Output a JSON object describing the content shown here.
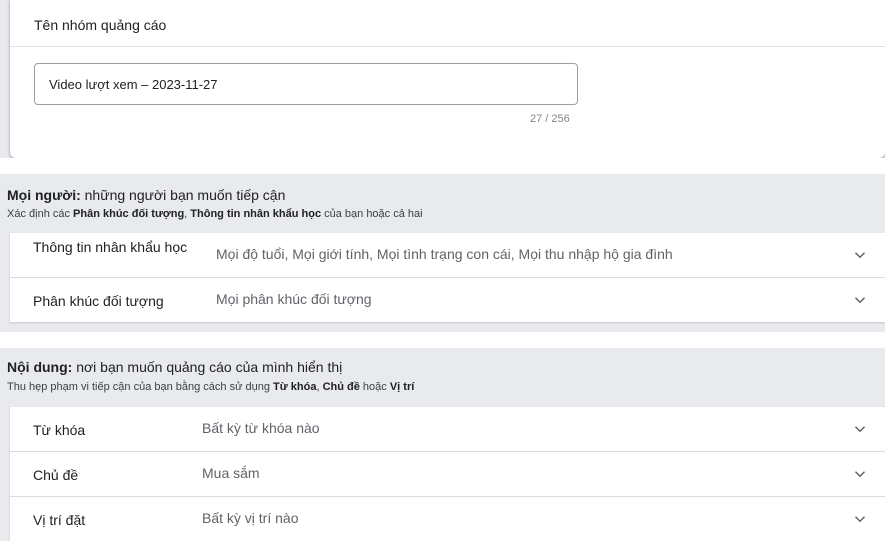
{
  "ad_group": {
    "title": "Tên nhóm quảng cáo",
    "name_value": "Video lượt xem – 2023-11-27",
    "char_count": "27 / 256"
  },
  "people": {
    "heading_bold": "Mọi người:",
    "heading_rest": " những người bạn muốn tiếp cận",
    "sub_prefix": "Xác định các ",
    "sub_bold1": "Phân khúc đối tượng",
    "sub_mid": ", ",
    "sub_bold2": "Thông tin nhân khẩu học",
    "sub_suffix": " của bạn hoặc cả hai",
    "rows": [
      {
        "label": "Thông tin nhân khẩu học",
        "value": "Mọi độ tuổi, Mọi giới tính, Mọi tình trạng con cái, Mọi thu nhập hộ gia đình"
      },
      {
        "label": "Phân khúc đối tượng",
        "value": "Mọi phân khúc đối tượng"
      }
    ]
  },
  "content": {
    "heading_bold": "Nội dung:",
    "heading_rest": " nơi bạn muốn quảng cáo của mình hiển thị",
    "sub_prefix": "Thu hẹp phạm vi tiếp cận của bạn bằng cách sử dụng ",
    "sub_bold1": "Từ khóa",
    "sub_mid1": ", ",
    "sub_bold2": "Chủ đề",
    "sub_mid2": " hoặc ",
    "sub_bold3": "Vị trí",
    "rows": [
      {
        "label": "Từ khóa",
        "value": "Bất kỳ từ khóa nào"
      },
      {
        "label": "Chủ đề",
        "value": "Mua sắm"
      },
      {
        "label": "Vị trí đặt",
        "value": "Bất kỳ vị trí nào"
      }
    ]
  },
  "icons": {
    "expand": "chevron-down-icon"
  }
}
